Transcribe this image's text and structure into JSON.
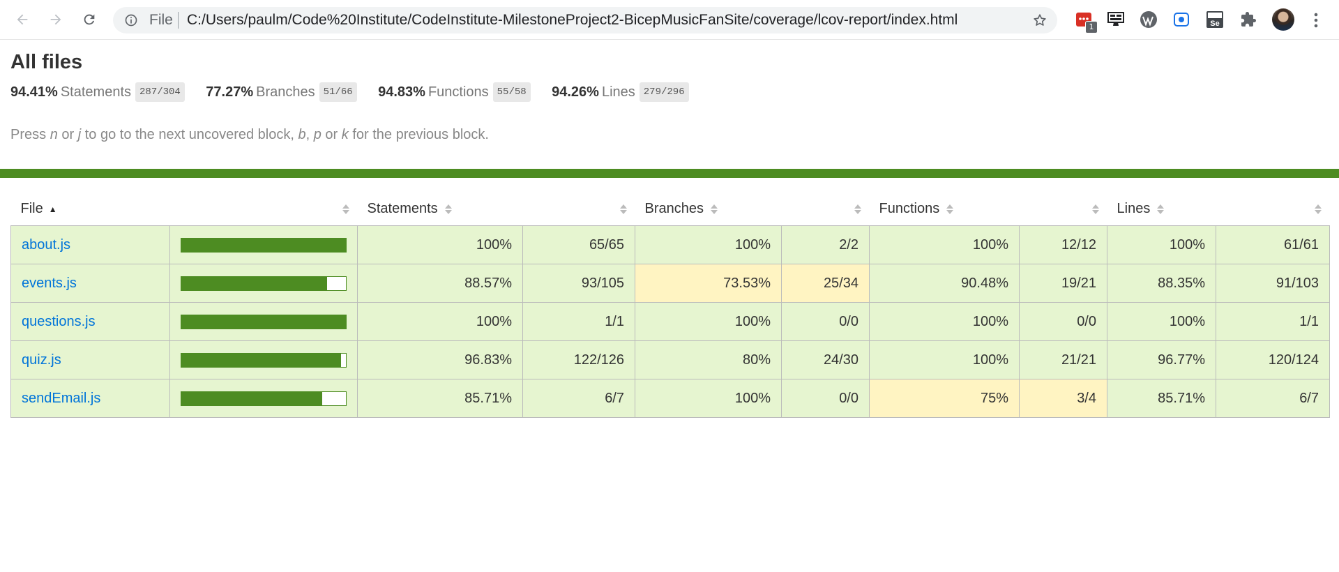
{
  "browser": {
    "omnibox": {
      "scheme_label": "File",
      "url": "C:/Users/paulm/Code%20Institute/CodeInstitute-MilestoneProject2-BicepMusicFanSite/coverage/lcov-report/index.html"
    },
    "extensions": [
      {
        "icon": "red-extension-icon",
        "badge": "1"
      },
      {
        "icon": "desktop-monitor-icon"
      },
      {
        "icon": "wordpress-icon"
      },
      {
        "icon": "screen-record-icon"
      },
      {
        "icon": "selenium-icon",
        "text": "Se"
      },
      {
        "icon": "puzzle-piece-icon"
      }
    ]
  },
  "report": {
    "title": "All files",
    "summary": [
      {
        "pct": "94.41%",
        "label": "Statements",
        "fraction": "287/304"
      },
      {
        "pct": "77.27%",
        "label": "Branches",
        "fraction": "51/66"
      },
      {
        "pct": "94.83%",
        "label": "Functions",
        "fraction": "55/58"
      },
      {
        "pct": "94.26%",
        "label": "Lines",
        "fraction": "279/296"
      }
    ],
    "hint": {
      "t1": "Press ",
      "k1": "n",
      "t2": " or ",
      "k2": "j",
      "t3": " to go to the next uncovered block, ",
      "k3": "b",
      "t4": ", ",
      "k4": "p",
      "t5": " or ",
      "k5": "k",
      "t6": " for the previous block."
    },
    "headers": {
      "file": "File",
      "statements": "Statements",
      "branches": "Branches",
      "functions": "Functions",
      "lines": "Lines"
    },
    "rows": [
      {
        "file": "about.js",
        "bar_fraction": 1.0,
        "stmt_pct": "100%",
        "stmt_frac": "65/65",
        "branch_pct": "100%",
        "branch_frac": "2/2",
        "func_pct": "100%",
        "func_frac": "12/12",
        "line_pct": "100%",
        "line_frac": "61/61"
      },
      {
        "file": "events.js",
        "bar_fraction": 0.8857,
        "stmt_pct": "88.57%",
        "stmt_frac": "93/105",
        "branch_pct": "73.53%",
        "branch_frac": "25/34",
        "func_pct": "90.48%",
        "func_frac": "19/21",
        "line_pct": "88.35%",
        "line_frac": "91/103"
      },
      {
        "file": "questions.js",
        "bar_fraction": 1.0,
        "stmt_pct": "100%",
        "stmt_frac": "1/1",
        "branch_pct": "100%",
        "branch_frac": "0/0",
        "func_pct": "100%",
        "func_frac": "0/0",
        "line_pct": "100%",
        "line_frac": "1/1"
      },
      {
        "file": "quiz.js",
        "bar_fraction": 0.9683,
        "stmt_pct": "96.83%",
        "stmt_frac": "122/126",
        "branch_pct": "80%",
        "branch_frac": "24/30",
        "func_pct": "100%",
        "func_frac": "21/21",
        "line_pct": "96.77%",
        "line_frac": "120/124"
      },
      {
        "file": "sendEmail.js",
        "bar_fraction": 0.8571,
        "stmt_pct": "85.71%",
        "stmt_frac": "6/7",
        "branch_pct": "100%",
        "branch_frac": "0/0",
        "func_pct": "75%",
        "func_frac": "3/4",
        "line_pct": "85.71%",
        "line_frac": "6/7"
      }
    ],
    "colors": {
      "high": "#e6f5d0",
      "medium": "#fff4c2",
      "bar": "#4d8c22",
      "link": "#0074d9"
    }
  }
}
